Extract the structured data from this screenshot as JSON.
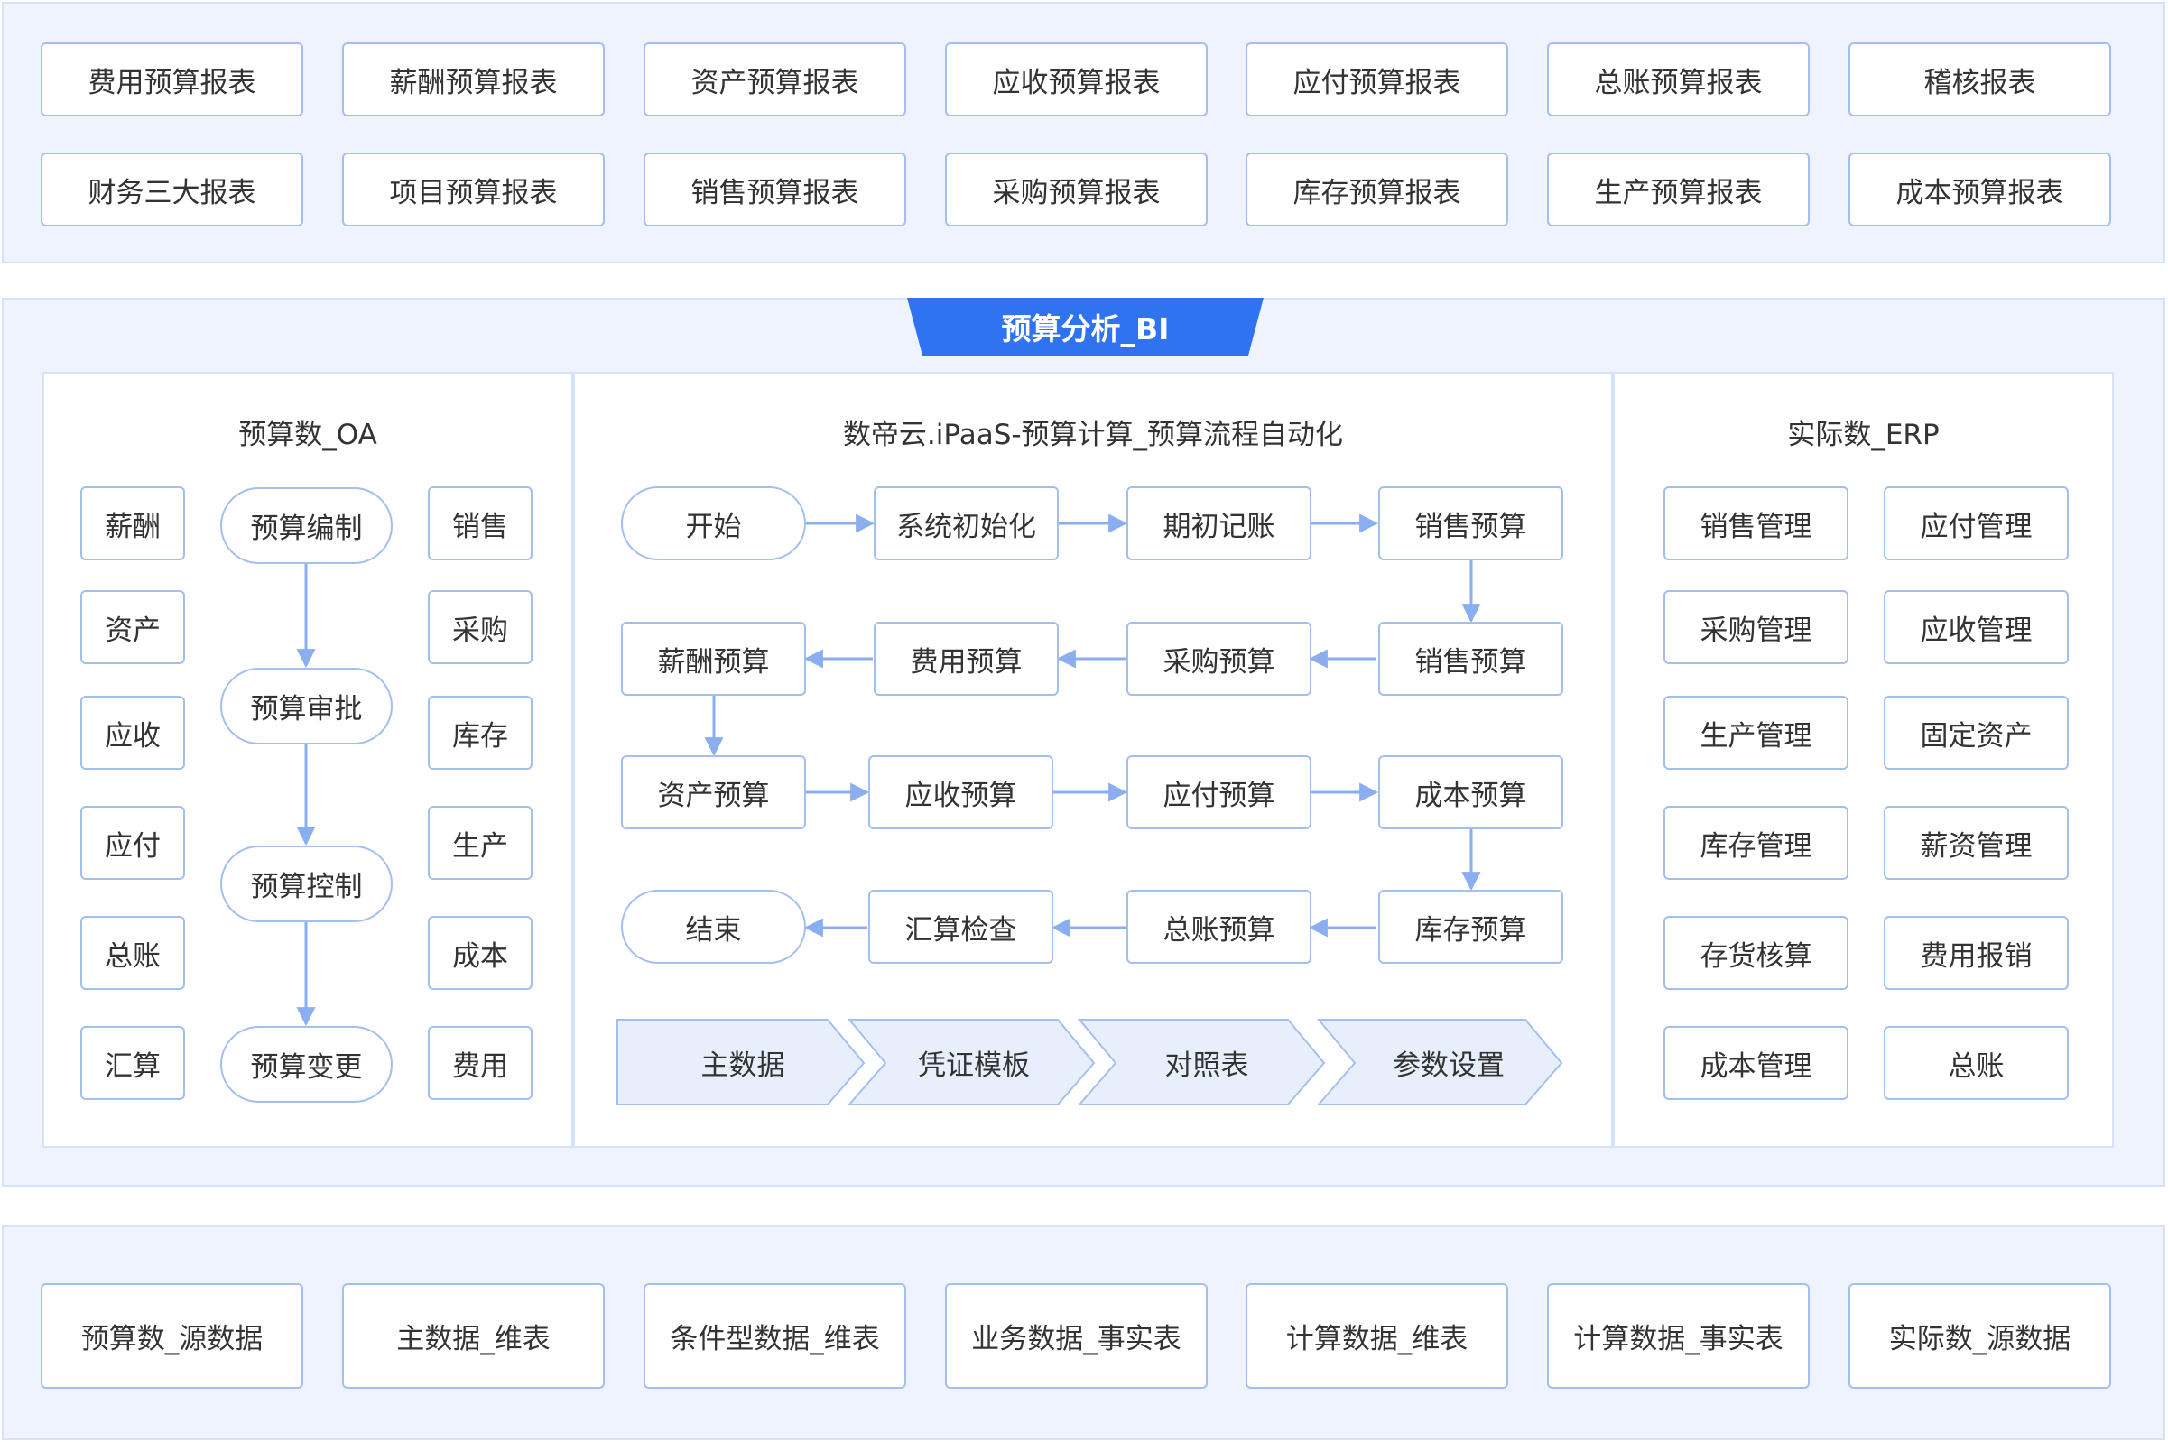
{
  "top_reports": [
    [
      "费用预算报表",
      "薪酬预算报表",
      "资产预算报表",
      "应收预算报表",
      "应付预算报表",
      "总账预算报表",
      "稽核报表"
    ],
    [
      "财务三大报表",
      "项目预算报表",
      "销售预算报表",
      "采购预算报表",
      "库存预算报表",
      "生产预算报表",
      "成本预算报表"
    ]
  ],
  "bi_title": "预算分析_BI",
  "oa": {
    "title": "预算数_OA",
    "left_items": [
      "薪酬",
      "资产",
      "应收",
      "应付",
      "总账",
      "汇算"
    ],
    "flow": [
      "预算编制",
      "预算审批",
      "预算控制",
      "预算变更"
    ],
    "right_items": [
      "销售",
      "采购",
      "库存",
      "生产",
      "成本",
      "费用"
    ]
  },
  "ipaas": {
    "title": "数帝云.iPaaS-预算计算_预算流程自动化",
    "row1": [
      "开始",
      "系统初始化",
      "期初记账",
      "销售预算"
    ],
    "row2": [
      "薪酬预算",
      "费用预算",
      "采购预算",
      "销售预算"
    ],
    "row3": [
      "资产预算",
      "应收预算",
      "应付预算",
      "成本预算"
    ],
    "row4": [
      "结束",
      "汇算检查",
      "总账预算",
      "库存预算"
    ],
    "steps": [
      "主数据",
      "凭证模板",
      "对照表",
      "参数设置"
    ]
  },
  "erp": {
    "title": "实际数_ERP",
    "items": [
      [
        "销售管理",
        "应付管理"
      ],
      [
        "采购管理",
        "应收管理"
      ],
      [
        "生产管理",
        "固定资产"
      ],
      [
        "库存管理",
        "薪资管理"
      ],
      [
        "存货核算",
        "费用报销"
      ],
      [
        "成本管理",
        "总账"
      ]
    ]
  },
  "bottom_sources": [
    "预算数_源数据",
    "主数据_维表",
    "条件型数据_维表",
    "业务数据_事实表",
    "计算数据_维表",
    "计算数据_事实表",
    "实际数_源数据"
  ],
  "colors": {
    "band_bg": "#eef3fd",
    "box_border": "#a3bff0",
    "arrow": "#8aaef0",
    "tab": "#2f73f0",
    "chevron_bg": "#e8effc"
  }
}
